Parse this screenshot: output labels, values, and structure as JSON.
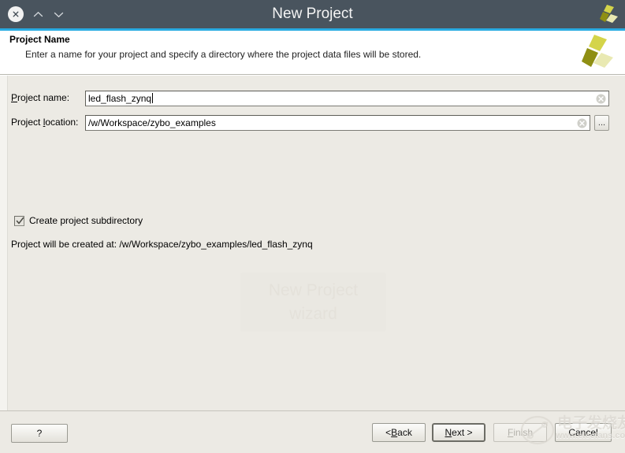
{
  "window": {
    "title": "New Project",
    "close_icon": "close-circle-icon",
    "collapse_icon": "chevron-up-icon",
    "expand_icon": "chevron-down-icon",
    "logo_icon": "xilinx-logo-icon",
    "accent_color": "#29abe2",
    "titlebar_color": "#49545e"
  },
  "header": {
    "title": "Project Name",
    "description": "Enter a name for your project and specify a directory where the project data files will be stored.",
    "logo_icon": "xilinx-logo-icon",
    "logo_color": "#c6c62e"
  },
  "ghost_watermark": {
    "line1": "New Project",
    "line2": "wizard"
  },
  "form": {
    "project_name": {
      "label_pre": "",
      "label_mnemonic": "P",
      "label_post": "roject name:",
      "value": "led_flash_zynq",
      "clear_icon": "clear-circle-icon"
    },
    "project_location": {
      "label_pre": "Project ",
      "label_mnemonic": "l",
      "label_post": "ocation:",
      "value": "/w/Workspace/zybo_examples",
      "clear_icon": "clear-circle-icon",
      "browse_label": "...",
      "browse_icon": "ellipsis-icon"
    },
    "create_subdirectory": {
      "label": "Create project subdirectory",
      "checked": true,
      "check_icon": "checkmark-icon"
    },
    "created_at": "Project will be created at: /w/Workspace/zybo_examples/led_flash_zynq"
  },
  "footer": {
    "help_label": "?",
    "back_pre": "< ",
    "back_mnemonic": "B",
    "back_post": "ack",
    "next_pre": "",
    "next_mnemonic": "N",
    "next_post": "ext >",
    "finish_pre": "",
    "finish_mnemonic": "F",
    "finish_post": "inish",
    "cancel_label": "Cancel"
  },
  "site_watermark": {
    "chinese": "电子发烧友",
    "url": "www.elecfans.com"
  }
}
